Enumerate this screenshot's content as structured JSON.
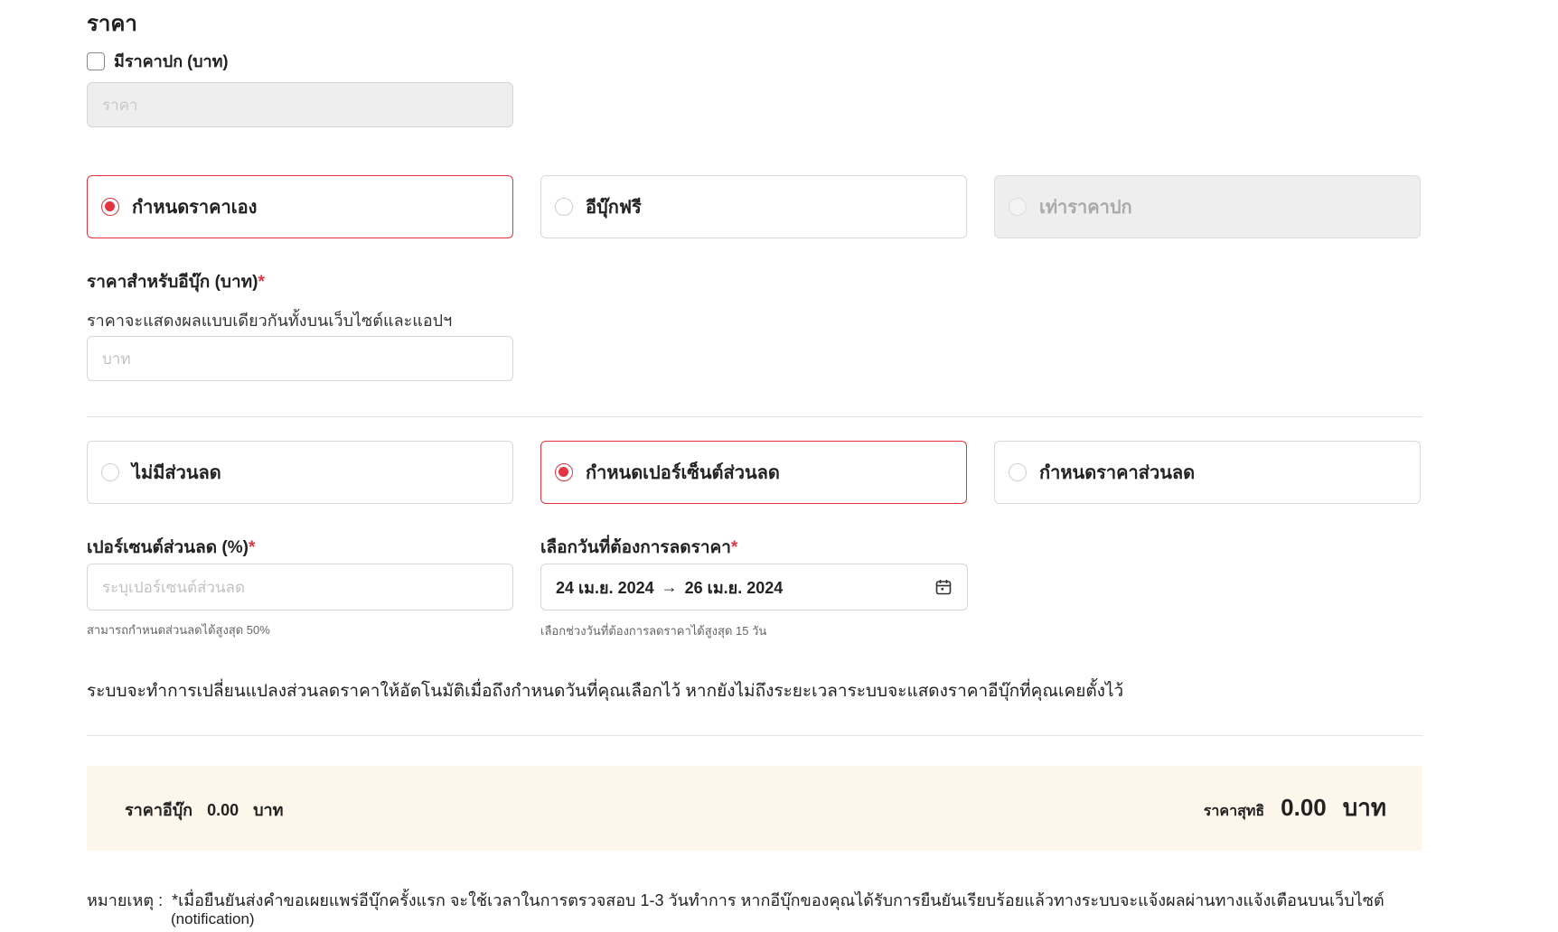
{
  "price_section": {
    "title": "ราคา",
    "cover_price_checkbox_label": "มีราคาปก (บาท)",
    "cover_price_checked": false,
    "price_placeholder": "ราคา"
  },
  "pricing_options": [
    {
      "label": "กำหนดราคาเอง",
      "selected": true,
      "disabled": false
    },
    {
      "label": "อีบุ๊กฟรี",
      "selected": false,
      "disabled": false
    },
    {
      "label": "เท่าราคาปก",
      "selected": false,
      "disabled": true
    }
  ],
  "ebook_price": {
    "label": "ราคาสำหรับอีบุ๊ก (บาท)",
    "required_mark": "*",
    "description": "ราคาจะแสดงผลแบบเดียวกันทั้งบนเว็บไซต์และแอปฯ",
    "placeholder": "บาท"
  },
  "discount_options": [
    {
      "label": "ไม่มีส่วนลด",
      "selected": false
    },
    {
      "label": "กำหนดเปอร์เซ็นต์ส่วนลด",
      "selected": true
    },
    {
      "label": "กำหนดราคาส่วนลด",
      "selected": false
    }
  ],
  "discount_percent": {
    "label": "เปอร์เซนต์ส่วนลด (%)",
    "required_mark": "*",
    "placeholder": "ระบุเปอร์เซนต์ส่วนลด",
    "hint": "สามารถกำหนดส่วนลดได้สูงสุด 50%"
  },
  "discount_dates": {
    "label": "เลือกวันที่ต้องการลดราคา",
    "required_mark": "*",
    "start": "24 เม.ย. 2024",
    "arrow": "→",
    "end": "26 เม.ย. 2024",
    "icon": "calendar-icon",
    "hint": "เลือกช่วงวันที่ต้องการลดราคาได้สูงสุด 15 วัน"
  },
  "notice": "ระบบจะทำการเปลี่ยนแปลงส่วนลดราคาให้อัตโนมัติเมื่อถึงกำหนดวันที่คุณเลือกไว้ หากยังไม่ถึงระยะเวลาระบบจะแสดงราคาอีบุ๊กที่คุณเคยตั้งไว้",
  "summary": {
    "ebook_price_label": "ราคาอีบุ๊ก",
    "ebook_price_value": "0.00",
    "ebook_price_unit": "บาท",
    "net_price_label": "ราคาสุทธิ",
    "net_price_value": "0.00",
    "net_price_unit": "บาท"
  },
  "remark": {
    "label": "หมายเหตุ :",
    "text": "*เมื่อยืนยันส่งคำขอเผยแพร่อีบุ๊กครั้งแรก จะใช้เวลาในการตรวจสอบ 1-3 วันทำการ หากอีบุ๊กของคุณได้รับการยืนยันเรียบร้อยแล้วทางระบบจะแจ้งผลผ่านทางแจ้งเตือนบนเว็บไซต์",
    "text_cont": "(notification)"
  },
  "colors": {
    "accent": "#e3343f",
    "summary_bg": "#fdf6ea"
  }
}
